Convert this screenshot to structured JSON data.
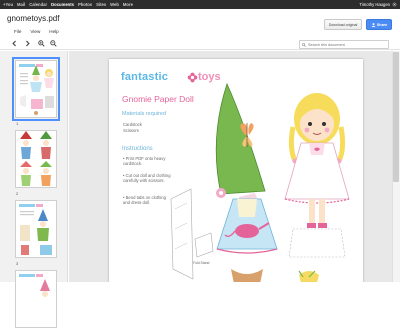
{
  "gbar": {
    "links": [
      "+You",
      "Mail",
      "Calendar",
      "Documents",
      "Photos",
      "Sites",
      "Web",
      "More"
    ],
    "active": "Documents",
    "user": "Timothy Haugen"
  },
  "header": {
    "file_title": "gnometoys.pdf",
    "menus": [
      "File",
      "View",
      "Help"
    ],
    "download_label": "Download original",
    "share_label": "Share"
  },
  "toolbar": {
    "search_placeholder": "Search this document"
  },
  "sidebar": {
    "page_numbers": [
      "1",
      "2",
      "3"
    ],
    "selected_page": "1"
  },
  "document": {
    "logo_left": "fantastic",
    "logo_right": "toys",
    "heading": "Gnomie Paper Doll",
    "materials_title": "Materials required",
    "materials": [
      "Cardstock",
      "Scissors"
    ],
    "instructions_title": "Instructions",
    "instructions": [
      "• Print PDF onto heavy cardstock.",
      "• Cut out doll and clothing carefully with scissors.",
      "• Bend tabs on clothing and dress doll."
    ],
    "fold_label": "Fold Stand"
  },
  "colors": {
    "gbar": "#2d2d2d",
    "share_button": "#4b8bf4",
    "selected_thumb": "#4d90fe",
    "logo_blue": "#5ab8e6",
    "logo_pink": "#f08fb8",
    "heading_pink": "#e4649a"
  },
  "icons": [
    "gear-icon",
    "share-person-icon",
    "back-arrow-icon",
    "forward-arrow-icon",
    "zoom-in-icon",
    "zoom-out-icon",
    "search-icon"
  ]
}
